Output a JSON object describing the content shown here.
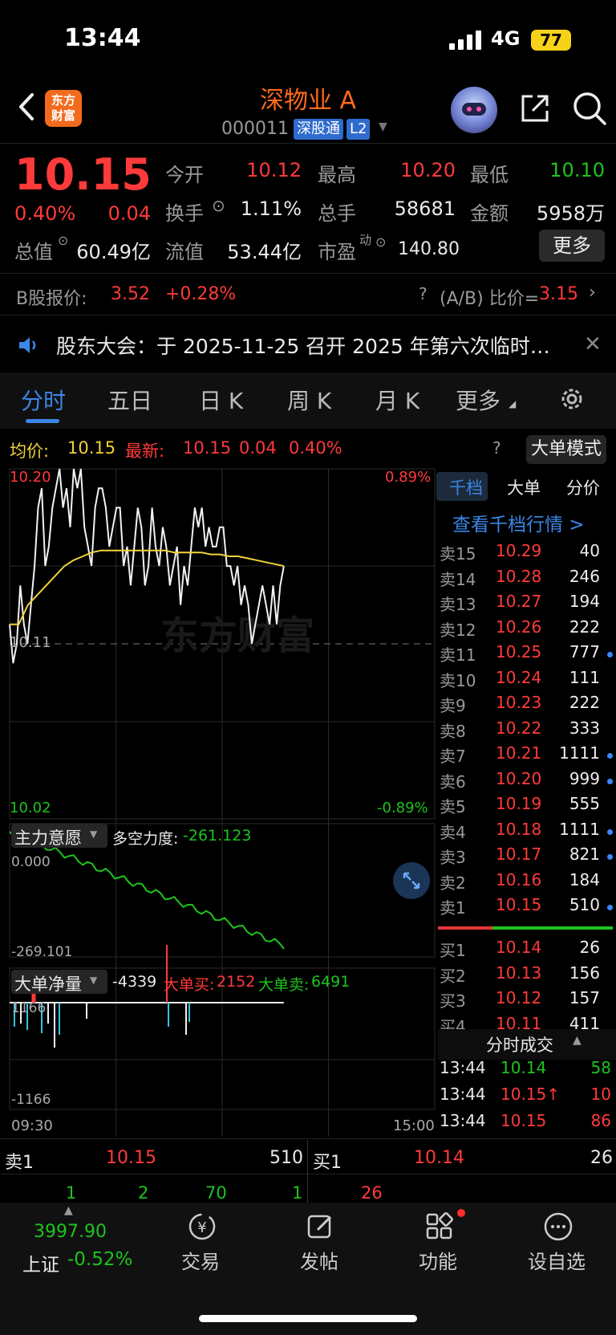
{
  "status_bar": {
    "time": "13:44",
    "network": "4G",
    "battery": "77"
  },
  "header": {
    "stock_name": "深物业 A",
    "stock_code": "000011",
    "badge_sgt": "深股通",
    "badge_l2": "L2",
    "logo_text_1": "东方",
    "logo_text_2": "财富"
  },
  "quote": {
    "price": "10.15",
    "change_pct": "0.40%",
    "change_amt": "0.04",
    "open_label": "今开",
    "open": "10.12",
    "high_label": "最高",
    "high": "10.20",
    "low_label": "最低",
    "low": "10.10",
    "turnover_label": "换手",
    "turnover": "1.11%",
    "volume_label": "总手",
    "volume": "58681",
    "amount_label": "金额",
    "amount": "5958万",
    "mcap_label": "总值",
    "mcap": "60.49亿",
    "float_label": "流值",
    "float_cap": "53.44亿",
    "pe_label": "市盈",
    "pe_sup": "动",
    "pe": "140.80",
    "more": "更多"
  },
  "b_share": {
    "label": "B股报价:",
    "price": "3.52",
    "change": "+0.28%",
    "ratio_label": "(A/B) 比价=",
    "ratio": "3.15"
  },
  "notice": {
    "text": "股东大会：于 2025-11-25 召开 2025 年第六次临时…"
  },
  "tabs": [
    "分时",
    "五日",
    "日 K",
    "周 K",
    "月 K",
    "更多"
  ],
  "chart": {
    "avg_label": "均价:",
    "avg": "10.15",
    "latest_label": "最新:",
    "latest": "10.15",
    "latest_chg": "0.04",
    "latest_pct": "0.40%",
    "big_order_mode": "大单模式",
    "y_top": "10.20",
    "y_mid": "10.11",
    "y_bottom": "10.02",
    "pct_top": "0.89%",
    "pct_bottom": "-0.89%",
    "watermark": "东方财富",
    "intent_label": "主力意愿",
    "force_label": "多空力度:",
    "force_value": "-261.123",
    "intent_top": "0.000",
    "intent_bottom": "-269.101",
    "net_label": "大单净量",
    "net_value": "-4339",
    "big_buy_label": "大单买:",
    "big_buy": "2152",
    "big_sell_label": "大单卖:",
    "big_sell": "6491",
    "net_top": "1166",
    "net_bottom": "-1166",
    "time_start": "09:30",
    "time_end": "15:00"
  },
  "chart_data": {
    "type": "line",
    "x_range": [
      "09:30",
      "15:00"
    ],
    "ylim": [
      10.02,
      10.2
    ],
    "ylabel_pct": [
      "0.89%",
      "-0.89%"
    ],
    "prev_close": 10.11,
    "series": [
      {
        "name": "最新",
        "values": [
          10.12,
          10.1,
          10.11,
          10.14,
          10.12,
          10.11,
          10.13,
          10.15,
          10.18,
          10.19,
          10.15,
          10.16,
          10.18,
          10.19,
          10.2,
          10.18,
          10.19,
          10.17,
          10.2,
          10.19,
          10.2,
          10.17,
          10.16,
          10.15,
          10.18,
          10.19,
          10.19,
          10.18,
          10.16,
          10.17,
          10.18,
          10.18,
          10.15,
          10.16,
          10.14,
          10.16,
          10.18,
          10.17,
          10.14,
          10.15,
          10.18,
          10.16,
          10.15,
          10.17,
          10.16,
          10.14,
          10.15,
          10.16,
          10.13,
          10.15,
          10.14,
          10.16,
          10.18,
          10.17,
          10.18,
          10.16,
          10.17,
          10.16,
          10.16,
          10.17,
          10.17,
          10.15,
          10.15,
          10.14,
          10.15,
          10.13,
          10.14,
          10.13,
          10.11,
          10.12,
          10.13,
          10.14,
          10.13,
          10.12,
          10.14,
          10.12,
          10.14,
          10.15
        ]
      },
      {
        "name": "均价",
        "values": [
          10.12,
          10.12,
          10.13,
          10.135,
          10.14,
          10.145,
          10.15,
          10.153,
          10.155,
          10.157,
          10.158,
          10.158,
          10.158,
          10.158,
          10.158,
          10.158,
          10.158,
          10.158,
          10.157,
          10.157,
          10.157,
          10.157,
          10.156,
          10.156,
          10.155,
          10.155,
          10.154,
          10.153,
          10.152,
          10.151,
          10.15
        ]
      }
    ],
    "order_book": {
      "sell": [
        {
          "label": "卖15",
          "price": "10.29",
          "vol": "40",
          "dot": false
        },
        {
          "label": "卖14",
          "price": "10.28",
          "vol": "246",
          "dot": false
        },
        {
          "label": "卖13",
          "price": "10.27",
          "vol": "194",
          "dot": false
        },
        {
          "label": "卖12",
          "price": "10.26",
          "vol": "222",
          "dot": false
        },
        {
          "label": "卖11",
          "price": "10.25",
          "vol": "777",
          "dot": true
        },
        {
          "label": "卖10",
          "price": "10.24",
          "vol": "111",
          "dot": false
        },
        {
          "label": "卖9",
          "price": "10.23",
          "vol": "222",
          "dot": false
        },
        {
          "label": "卖8",
          "price": "10.22",
          "vol": "333",
          "dot": false
        },
        {
          "label": "卖7",
          "price": "10.21",
          "vol": "1111",
          "dot": true
        },
        {
          "label": "卖6",
          "price": "10.20",
          "vol": "999",
          "dot": true
        },
        {
          "label": "卖5",
          "price": "10.19",
          "vol": "555",
          "dot": false
        },
        {
          "label": "卖4",
          "price": "10.18",
          "vol": "1111",
          "dot": true
        },
        {
          "label": "卖3",
          "price": "10.17",
          "vol": "821",
          "dot": true
        },
        {
          "label": "卖2",
          "price": "10.16",
          "vol": "184",
          "dot": false
        },
        {
          "label": "卖1",
          "price": "10.15",
          "vol": "510",
          "dot": true
        }
      ],
      "buy": [
        {
          "label": "买1",
          "price": "10.14",
          "vol": "26"
        },
        {
          "label": "买2",
          "price": "10.13",
          "vol": "156"
        },
        {
          "label": "买3",
          "price": "10.12",
          "vol": "157"
        },
        {
          "label": "买4",
          "price": "10.11",
          "vol": "411"
        }
      ]
    }
  },
  "order_book_tabs": [
    "千档",
    "大单",
    "分价"
  ],
  "order_book_link": "查看千档行情 >",
  "ticks": {
    "title": "分时成交",
    "rows": [
      {
        "time": "13:44",
        "price": "10.14",
        "vol": "58",
        "color": "green"
      },
      {
        "time": "13:44",
        "price": "10.15↑",
        "vol": "10",
        "color": "red"
      },
      {
        "time": "13:44",
        "price": "10.15",
        "vol": "86",
        "color": "red"
      }
    ]
  },
  "bottom_quote": {
    "sell1_label": "卖1",
    "sell1_price": "10.15",
    "sell1_vol": "510",
    "buy1_label": "买1",
    "buy1_price": "10.14",
    "buy1_vol": "26",
    "row2_a": "1",
    "row2_b": "2",
    "row2_c": "70",
    "row2_d": "1",
    "row2_e": "26"
  },
  "bottom_nav": {
    "index_value": "3997.90",
    "index_name": "上证",
    "index_pct": "-0.52%",
    "items": [
      "交易",
      "发帖",
      "功能",
      "设自选"
    ]
  }
}
